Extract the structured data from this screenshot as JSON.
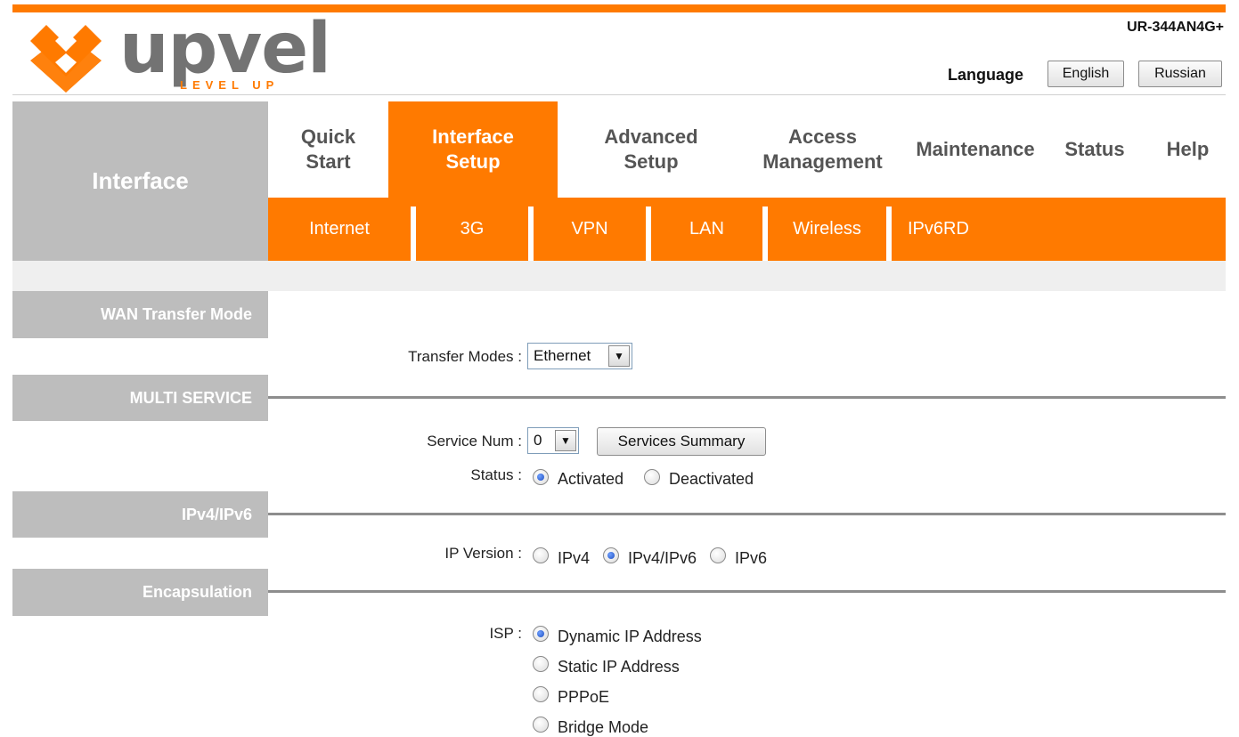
{
  "header": {
    "logo_text": "upvel",
    "logo_tagline": "LEVEL UP",
    "model": "UR-344AN4G+",
    "language_label": "Language",
    "language_buttons": [
      "English",
      "Russian"
    ]
  },
  "nav": {
    "section_title": "Interface",
    "items": [
      {
        "label": "Quick\nStart",
        "active": false
      },
      {
        "label": "Interface\nSetup",
        "active": true
      },
      {
        "label": "Advanced\nSetup",
        "active": false
      },
      {
        "label": "Access\nManagement",
        "active": false
      },
      {
        "label": "Maintenance",
        "active": false
      },
      {
        "label": "Status",
        "active": false
      },
      {
        "label": "Help",
        "active": false
      }
    ],
    "sub_items": [
      "Internet",
      "3G",
      "VPN",
      "LAN",
      "Wireless",
      "IPv6RD"
    ]
  },
  "sections": {
    "wan": {
      "title": "WAN Transfer Mode",
      "transfer_label": "Transfer Modes :",
      "transfer_value": "Ethernet"
    },
    "multi": {
      "title": "MULTI SERVICE",
      "service_label": "Service Num :",
      "service_value": "0",
      "summary_button": "Services Summary",
      "status_label": "Status :",
      "status_options": [
        "Activated",
        "Deactivated"
      ],
      "status_selected": "Activated"
    },
    "ip": {
      "title": "IPv4/IPv6",
      "ip_label": "IP Version :",
      "ip_options": [
        "IPv4",
        "IPv4/IPv6",
        "IPv6"
      ],
      "ip_selected": "IPv4/IPv6"
    },
    "encap": {
      "title": "Encapsulation",
      "isp_label": "ISP :",
      "isp_options": [
        "Dynamic IP Address",
        "Static IP Address",
        "PPPoE",
        "Bridge Mode"
      ],
      "isp_selected": "Dynamic IP Address"
    }
  },
  "colors": {
    "accent": "#ff7a00",
    "grey_panel": "#bdbdbd"
  }
}
